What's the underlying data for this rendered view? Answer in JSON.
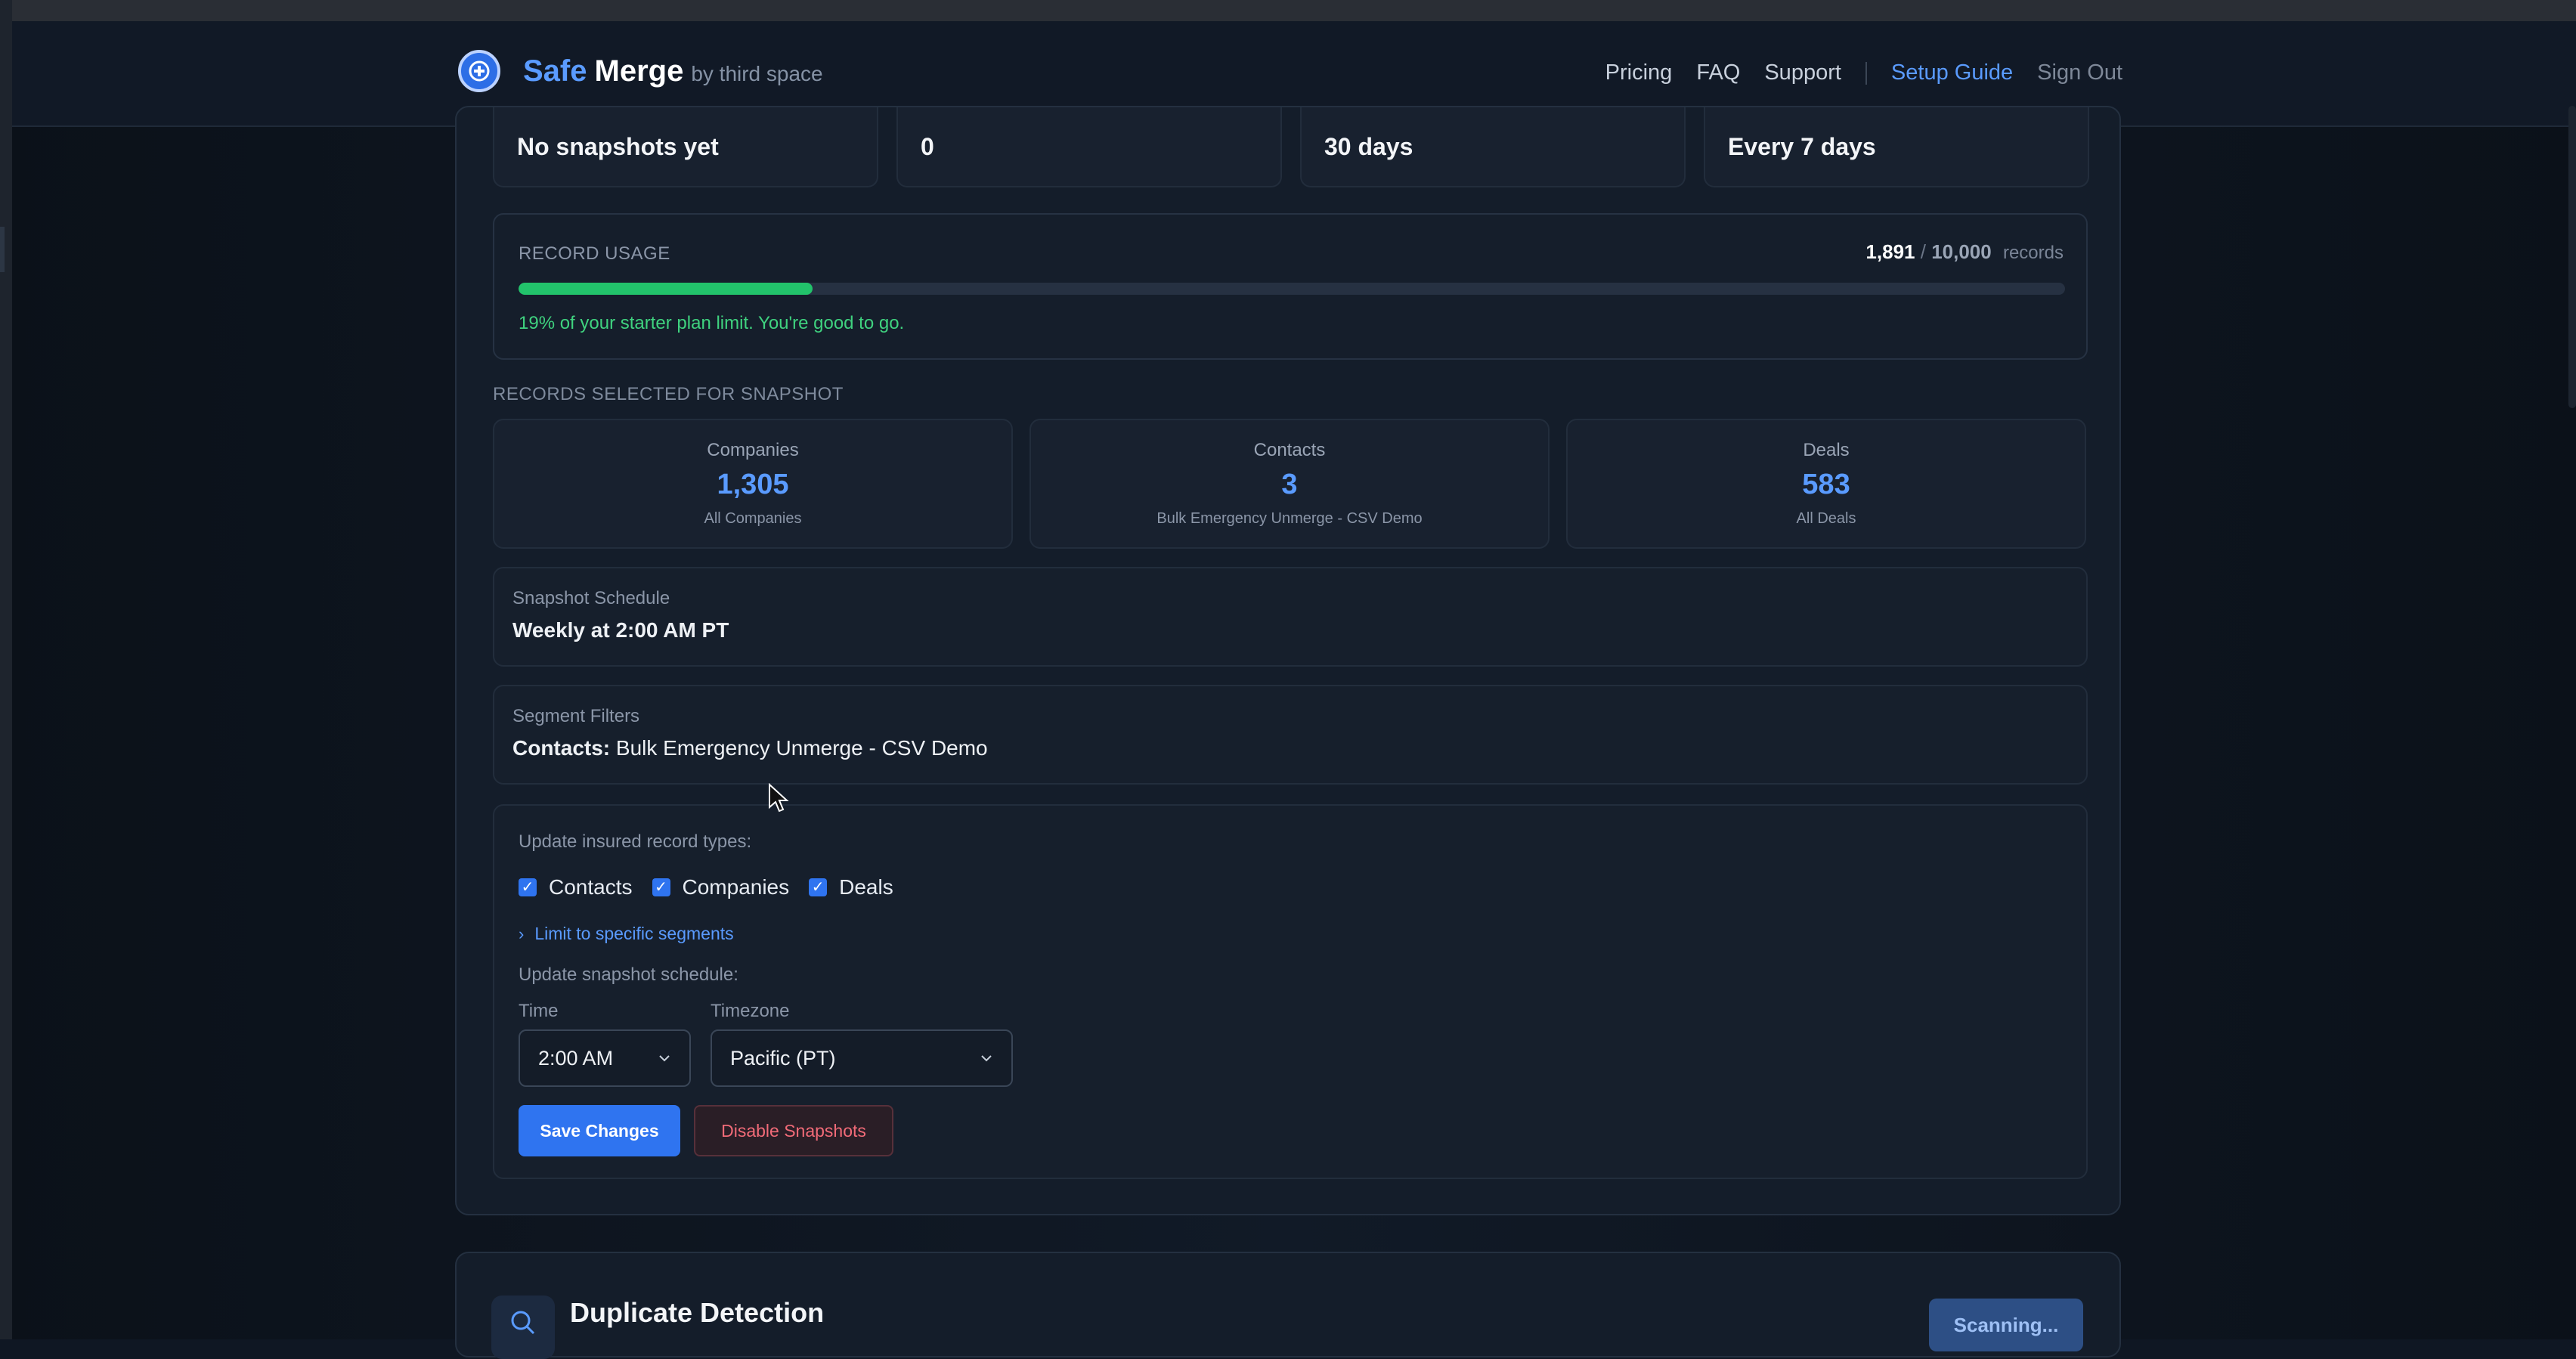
{
  "header": {
    "brand_safe": "Safe",
    "brand_merge": "Merge",
    "brand_by": "by third space",
    "nav": {
      "pricing": "Pricing",
      "faq": "FAQ",
      "support": "Support",
      "setup_guide": "Setup Guide",
      "sign_out": "Sign Out"
    }
  },
  "stats": [
    {
      "value": "No snapshots yet"
    },
    {
      "value": "0"
    },
    {
      "value": "30 days"
    },
    {
      "value": "Every 7 days"
    }
  ],
  "usage": {
    "label": "RECORD USAGE",
    "used": "1,891",
    "slash": "/",
    "limit": "10,000",
    "unit": "records",
    "percent": 19,
    "note": "19% of your starter plan limit. You're good to go."
  },
  "selected": {
    "label": "RECORDS SELECTED FOR SNAPSHOT",
    "cards": [
      {
        "title": "Companies",
        "count": "1,305",
        "sub": "All Companies"
      },
      {
        "title": "Contacts",
        "count": "3",
        "sub": "Bulk Emergency Unmerge - CSV Demo"
      },
      {
        "title": "Deals",
        "count": "583",
        "sub": "All Deals"
      }
    ]
  },
  "schedule": {
    "label": "Snapshot Schedule",
    "value": "Weekly at 2:00 AM PT"
  },
  "segments": {
    "label": "Segment Filters",
    "key": "Contacts:",
    "value": "Bulk Emergency Unmerge - CSV Demo"
  },
  "edit": {
    "types_label": "Update insured record types:",
    "types": [
      "Contacts",
      "Companies",
      "Deals"
    ],
    "limit_link": "Limit to specific segments",
    "schedule_label": "Update snapshot schedule:",
    "time_label": "Time",
    "time_value": "2:00 AM",
    "tz_label": "Timezone",
    "tz_value": "Pacific (PT)",
    "save": "Save Changes",
    "disable": "Disable Snapshots"
  },
  "duplicate": {
    "title": "Duplicate Detection",
    "button": "Scanning..."
  },
  "colors": {
    "accent": "#2f74f0",
    "success": "#22c36b",
    "danger": "#f26b78"
  }
}
